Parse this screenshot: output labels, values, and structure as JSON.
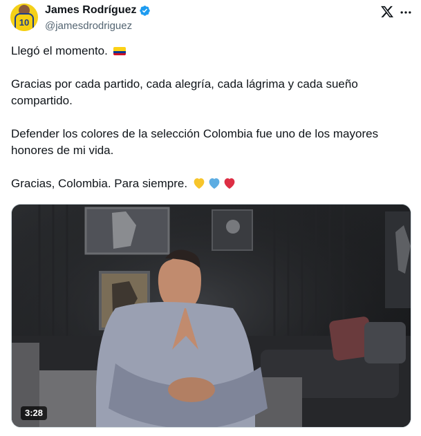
{
  "author": {
    "name": "James Rodríguez",
    "handle": "@jamesdrodriguez",
    "avatar_number": "10",
    "verified": true
  },
  "icons": {
    "platform": "x-logo-icon",
    "menu": "more-options-icon",
    "verified": "verified-badge-icon"
  },
  "tweet": {
    "line1": "Llegó el momento.",
    "line2": "Gracias por cada partido, cada alegría, cada lágrima y cada sueño compartido.",
    "line3": "Defender los colores de la selección Colombia fue uno de los mayores honores de mi vida.",
    "line4": "Gracias, Colombia. Para siempre."
  },
  "emoji_colors": {
    "heart_yellow": "#f7c52b",
    "heart_blue": "#5dade2",
    "heart_red": "#dd2e44",
    "flag_yellow": "#fcd116",
    "flag_blue": "#003893",
    "flag_red": "#ce1126"
  },
  "video": {
    "duration": "3:28"
  },
  "colors": {
    "verified_blue": "#1d9bf0",
    "text": "#0f1419",
    "muted": "#536471"
  }
}
